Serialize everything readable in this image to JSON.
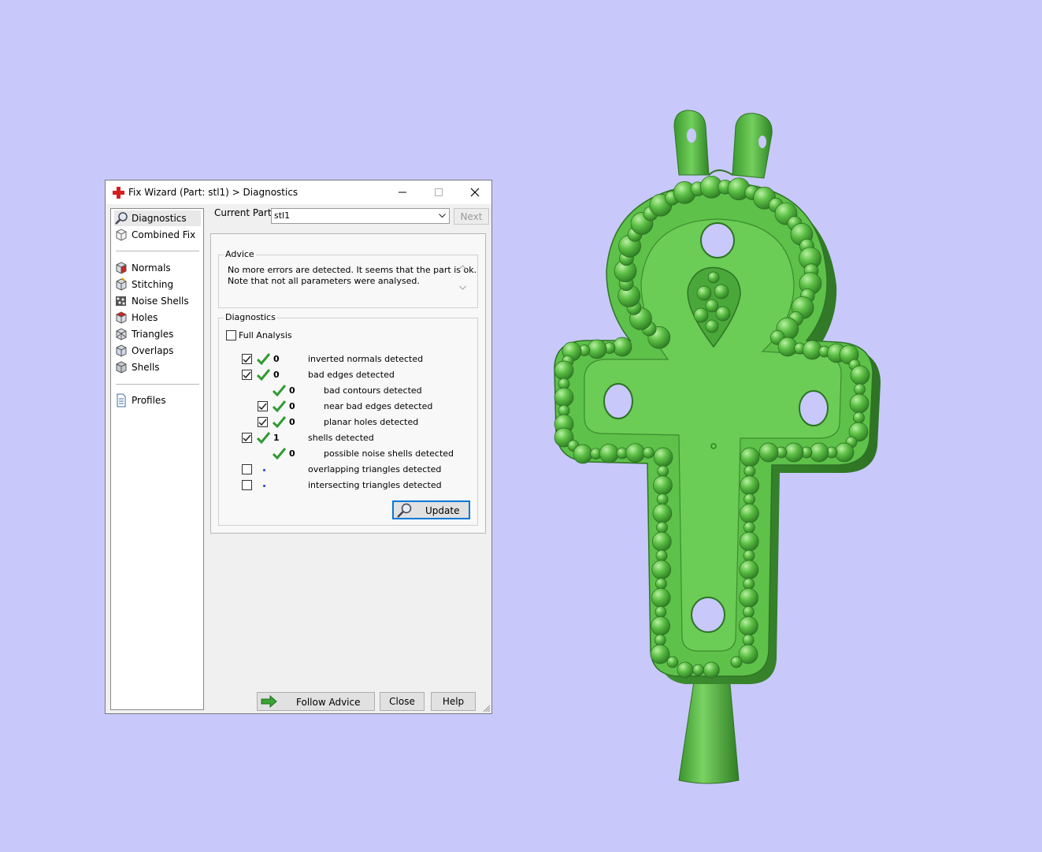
{
  "window": {
    "title": "Fix Wizard (Part: stl1) > Diagnostics",
    "app_icon": "red-cross-icon"
  },
  "sidebar": {
    "items_top": [
      {
        "label": "Diagnostics",
        "icon": "magnifier-icon",
        "active": true
      },
      {
        "label": "Combined Fix",
        "icon": "cube-outline-icon"
      }
    ],
    "items_fix": [
      {
        "label": "Normals",
        "icon": "normals-cube-icon"
      },
      {
        "label": "Stitching",
        "icon": "stitching-cube-icon"
      },
      {
        "label": "Noise Shells",
        "icon": "noise-shells-icon"
      },
      {
        "label": "Holes",
        "icon": "holes-cube-icon"
      },
      {
        "label": "Triangles",
        "icon": "triangles-cube-icon"
      },
      {
        "label": "Overlaps",
        "icon": "overlaps-cube-icon"
      },
      {
        "label": "Shells",
        "icon": "shells-cube-icon"
      }
    ],
    "items_bottom": [
      {
        "label": "Profiles",
        "icon": "document-icon"
      }
    ]
  },
  "header": {
    "current_part_label": "Current Part:",
    "current_part_value": "stl1",
    "next_label": "Next"
  },
  "advice": {
    "title": "Advice",
    "text": "No more errors are detected. It seems that the part is ok.\nNote that not all parameters were analysed."
  },
  "diagnostics": {
    "title": "Diagnostics",
    "full_analysis_label": "Full Analysis",
    "full_analysis_checked": false,
    "rows": [
      {
        "checkbox": true,
        "checked": true,
        "status": "ok",
        "count": "0",
        "label": "inverted normals detected",
        "indent": 0
      },
      {
        "checkbox": true,
        "checked": true,
        "status": "ok",
        "count": "0",
        "label": "bad edges detected",
        "indent": 0
      },
      {
        "checkbox": false,
        "checked": false,
        "status": "ok",
        "count": "0",
        "label": "bad contours detected",
        "indent": 1
      },
      {
        "checkbox": true,
        "checked": true,
        "status": "ok",
        "count": "0",
        "label": "near bad edges detected",
        "indent": 1
      },
      {
        "checkbox": true,
        "checked": true,
        "status": "ok",
        "count": "0",
        "label": "planar holes detected",
        "indent": 1
      },
      {
        "checkbox": true,
        "checked": true,
        "status": "ok",
        "count": "1",
        "label": "shells detected",
        "indent": 0
      },
      {
        "checkbox": false,
        "checked": false,
        "status": "ok",
        "count": "0",
        "label": "possible noise shells detected",
        "indent": 1
      },
      {
        "checkbox": true,
        "checked": false,
        "status": "pending",
        "count": "",
        "label": "overlapping triangles detected",
        "indent": 0
      },
      {
        "checkbox": true,
        "checked": false,
        "status": "pending",
        "count": "",
        "label": "intersecting triangles detected",
        "indent": 0
      }
    ],
    "update_label": "Update"
  },
  "footer": {
    "follow_advice_label": "Follow Advice",
    "close_label": "Close",
    "help_label": "Help"
  },
  "colors": {
    "viewport_bg": "#c8c8fb",
    "model_green": "#4fb33e",
    "check_green": "#2f9a2f",
    "focus_blue": "#0078d7"
  }
}
